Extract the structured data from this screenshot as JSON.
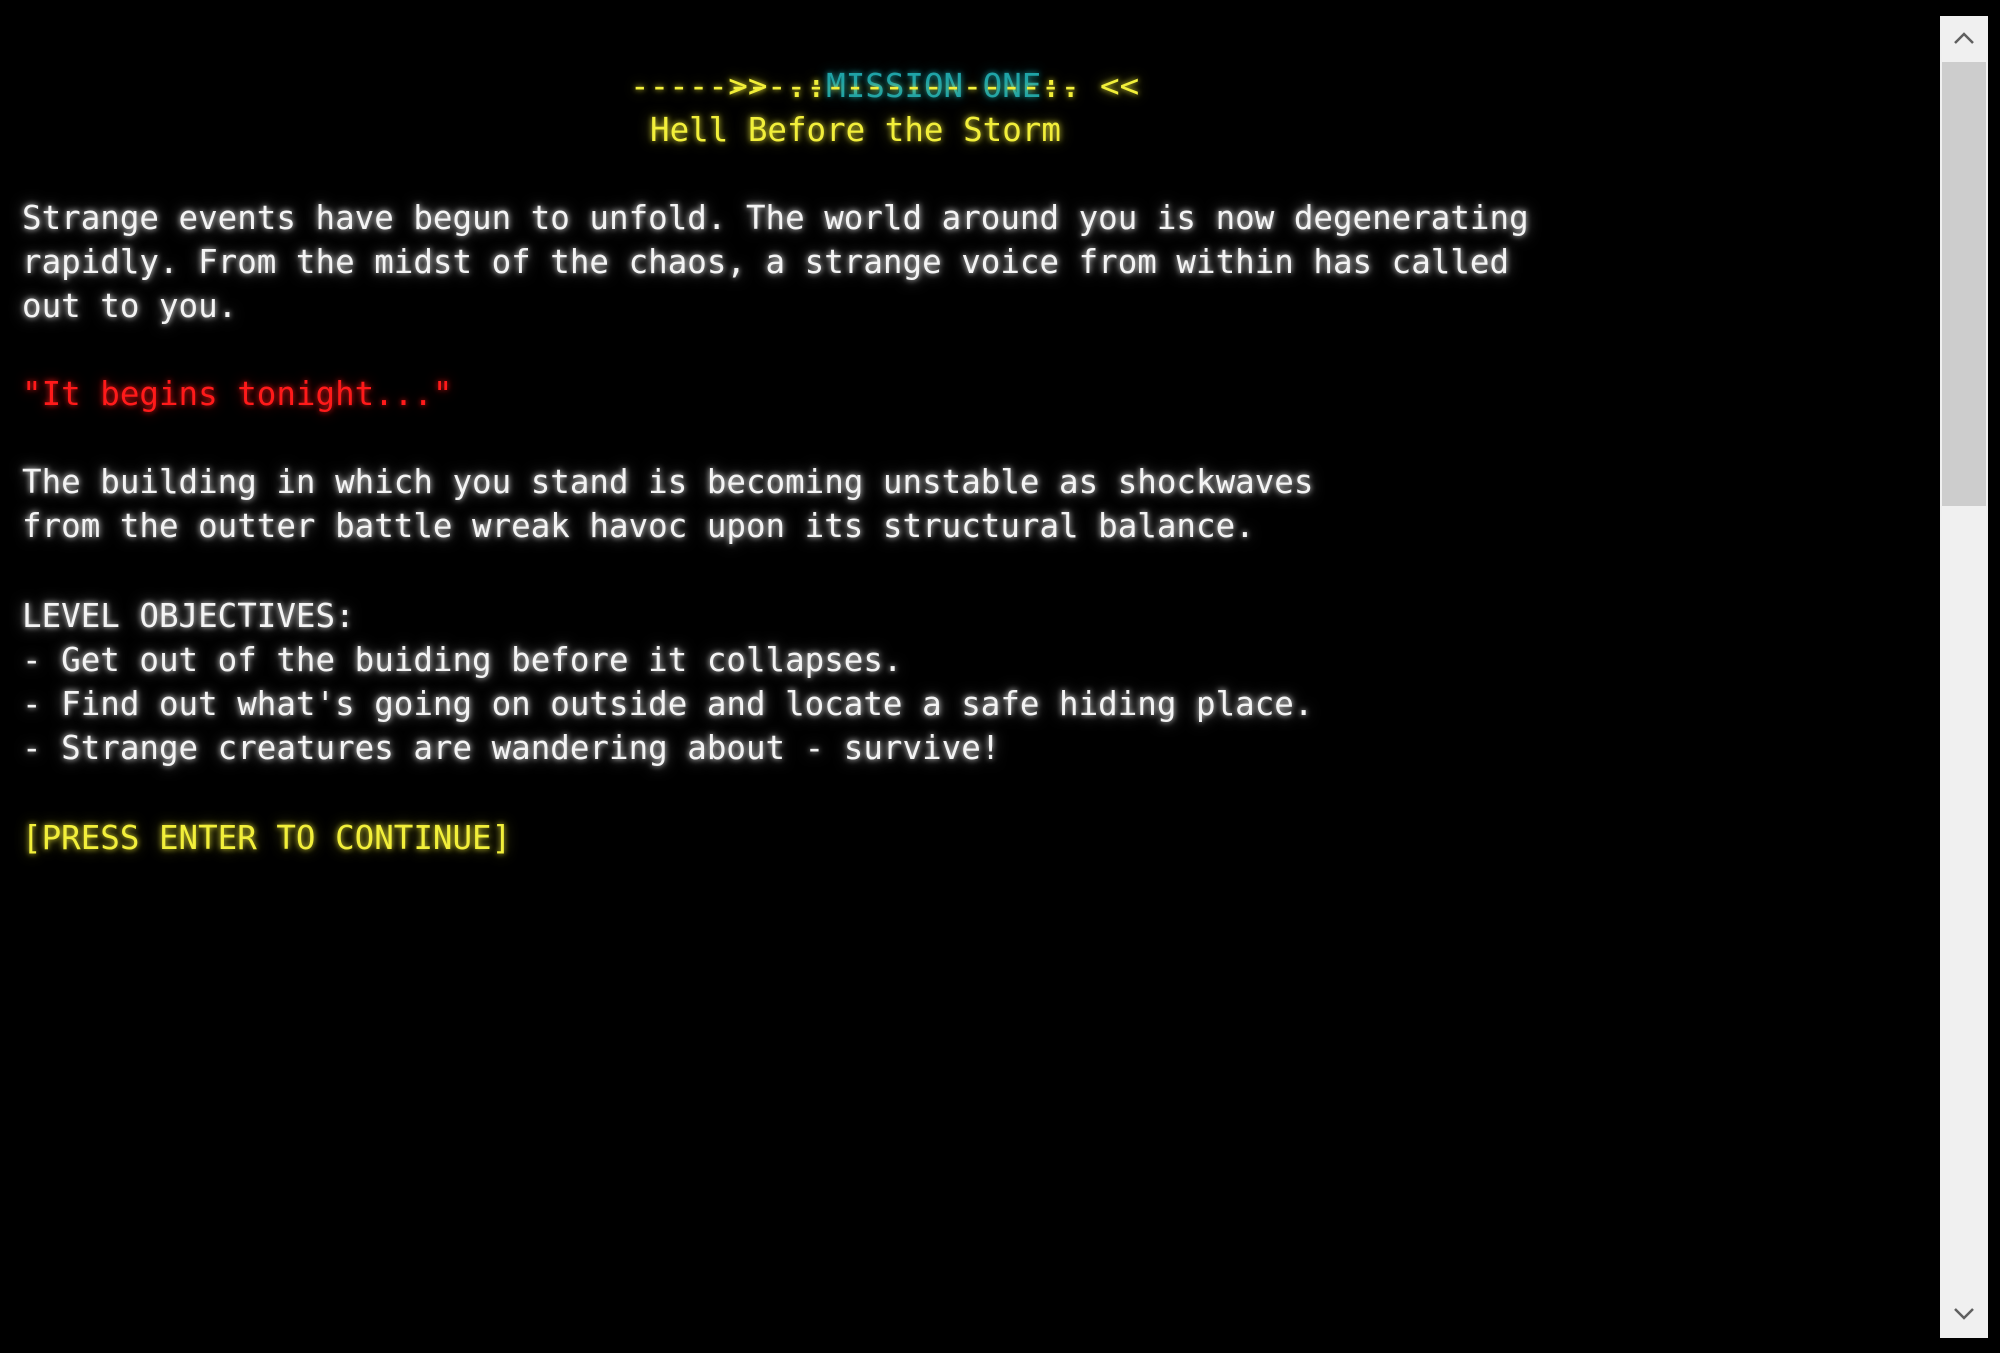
{
  "header": {
    "prefix": ">> .:",
    "mission": "MISSION ONE",
    "suffix": ":. <<",
    "divider": "-----------------------",
    "title": "Hell Before the Storm"
  },
  "intro": [
    "Strange events have begun to unfold. The world around you is now degenerating",
    "rapidly. From the midst of the chaos, a strange voice from within has called",
    "out to you."
  ],
  "quote": "\"It begins tonight...\"",
  "situation": [
    "The building in which you stand is becoming unstable as shockwaves",
    "from the outter battle wreak havoc upon its structural balance."
  ],
  "objectives": {
    "heading": "LEVEL OBJECTIVES:",
    "items": [
      "- Get out of the buiding before it collapses.",
      "- Find out what's going on outside and locate a safe hiding place.",
      "- Strange creatures are wandering about - survive!"
    ]
  },
  "prompt": "[PRESS ENTER TO CONTINUE]",
  "scrollbar": {
    "up_icon": "chevron-up-icon",
    "down_icon": "chevron-down-icon",
    "position": 0.0
  },
  "colors": {
    "background": "#000000",
    "text": "#f4f4f4",
    "accent_yellow": "#f2ef3a",
    "accent_teal": "#1fa3a8",
    "accent_red": "#ff1a1a"
  }
}
